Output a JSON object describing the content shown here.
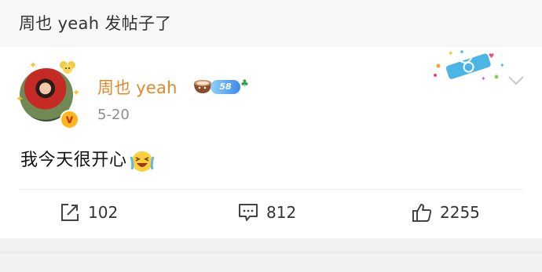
{
  "header": {
    "title": "周也 yeah 发帖子了"
  },
  "post": {
    "author": {
      "name": "周也 yeah",
      "level": "58",
      "verified_icon": "verified-v-icon"
    },
    "date": "5-20",
    "text": "我今天很开心",
    "emoji": "laughing-emoji",
    "decoration": "taurus-sign-decoration",
    "menu_icon": "chevron-down-icon"
  },
  "actions": {
    "repost": {
      "icon": "repost-icon",
      "count": "102"
    },
    "comment": {
      "icon": "comment-icon",
      "count": "812"
    },
    "like": {
      "icon": "like-thumb-icon",
      "count": "2255"
    }
  },
  "colors": {
    "username": "#e6862b",
    "date": "#8c8c8c",
    "header_bg": "#f7f7f7",
    "level_badge": "#3d88e8"
  }
}
